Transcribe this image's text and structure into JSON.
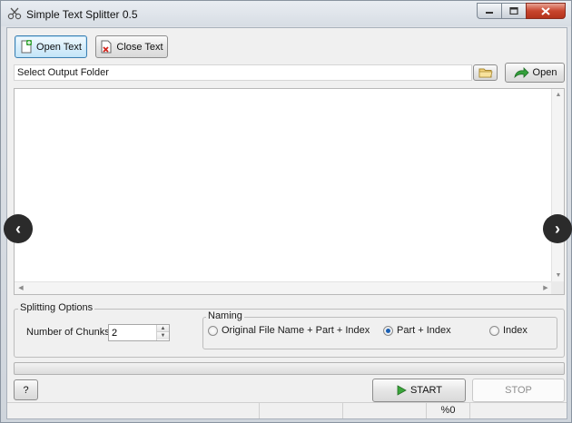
{
  "window": {
    "title": "Simple Text Splitter 0.5",
    "controls": [
      "minimize",
      "maximize",
      "close"
    ]
  },
  "toolbar": {
    "open_text_label": "Open Text",
    "close_text_label": "Close Text",
    "open_text_icon": "document-add-icon",
    "close_text_icon": "document-remove-icon"
  },
  "output": {
    "folder_label": "Select Output Folder",
    "browse_icon": "folder-icon",
    "open_label": "Open",
    "open_icon": "go-arrow-icon"
  },
  "editor": {
    "content": ""
  },
  "navigation": {
    "prev_glyph": "‹",
    "next_glyph": "›"
  },
  "splitting_options": {
    "group_label": "Splitting Options",
    "chunks_label": "Number of Chunks:",
    "chunks_value": "2",
    "naming": {
      "group_label": "Naming",
      "options": [
        {
          "label": "Original File Name + Part + Index",
          "checked": false
        },
        {
          "label": "Part + Index",
          "checked": true
        },
        {
          "label": "Index",
          "checked": false
        }
      ]
    }
  },
  "progress": {
    "fraction": 0
  },
  "actions": {
    "help_label": "?",
    "start_label": "START",
    "stop_label": "STOP"
  },
  "status": {
    "percent_text": "%0"
  },
  "colors": {
    "accent": "#3c7fb1",
    "start_icon": "#3aa53a"
  }
}
